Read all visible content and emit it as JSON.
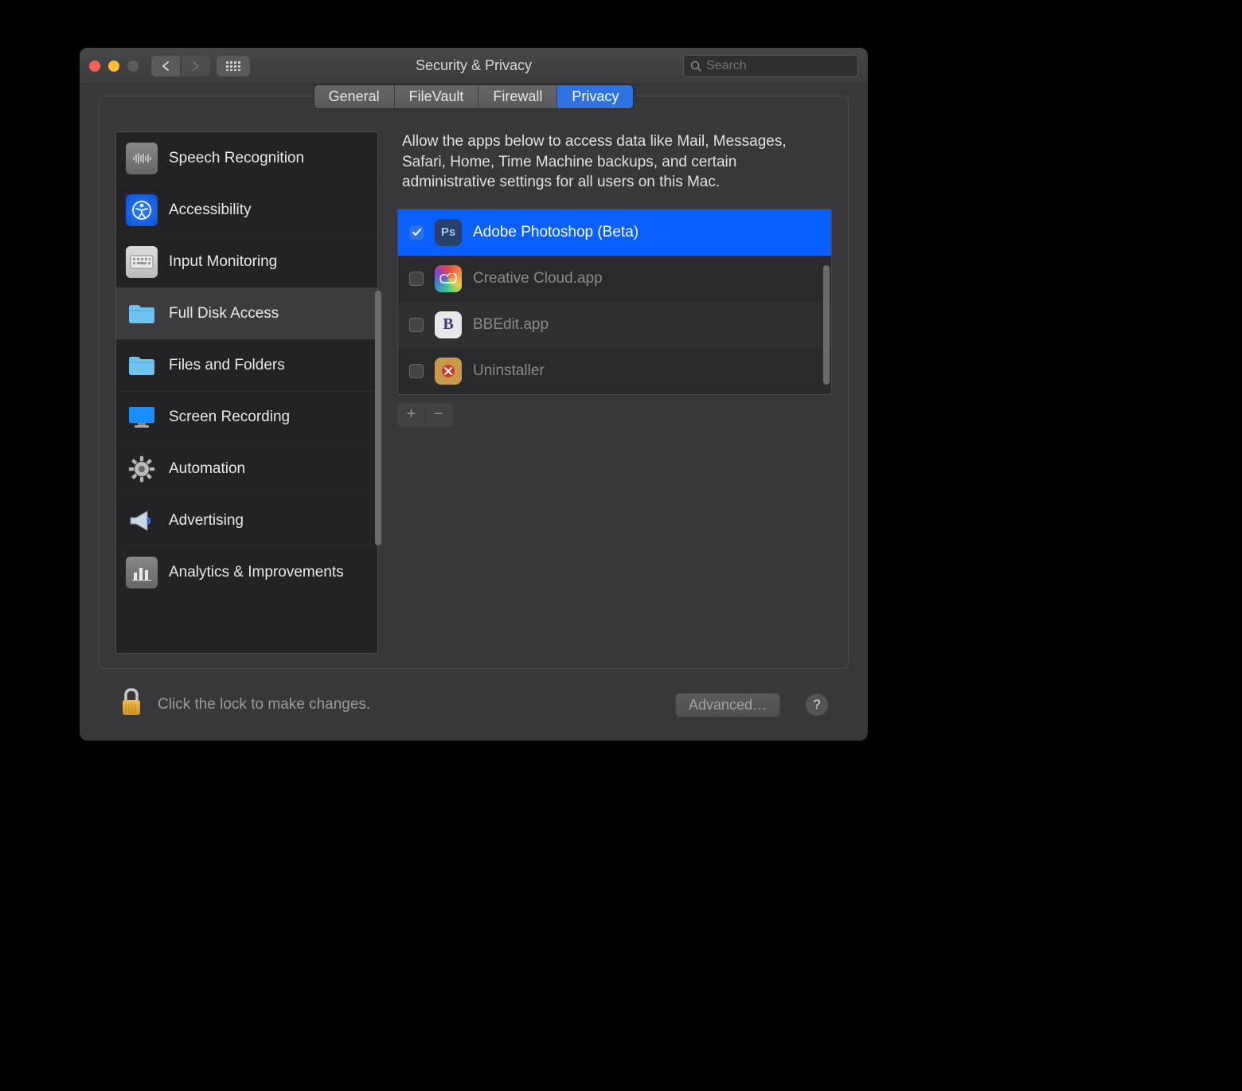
{
  "window": {
    "title": "Security & Privacy"
  },
  "search": {
    "placeholder": "Search"
  },
  "tabs": [
    {
      "label": "General",
      "active": false
    },
    {
      "label": "FileVault",
      "active": false
    },
    {
      "label": "Firewall",
      "active": false
    },
    {
      "label": "Privacy",
      "active": true
    }
  ],
  "sidebar": {
    "items": [
      {
        "label": "Speech Recognition"
      },
      {
        "label": "Accessibility"
      },
      {
        "label": "Input Monitoring"
      },
      {
        "label": "Full Disk Access"
      },
      {
        "label": "Files and Folders"
      },
      {
        "label": "Screen Recording"
      },
      {
        "label": "Automation"
      },
      {
        "label": "Advertising"
      },
      {
        "label": "Analytics & Improvements"
      }
    ],
    "selected_index": 3
  },
  "detail": {
    "description": "Allow the apps below to access data like Mail, Messages, Safari, Home, Time Machine backups, and certain administrative settings for all users on this Mac.",
    "apps": [
      {
        "name": "Adobe Photoshop (Beta)",
        "checked": true,
        "selected": true
      },
      {
        "name": "Creative Cloud.app",
        "checked": false,
        "selected": false
      },
      {
        "name": "BBEdit.app",
        "checked": false,
        "selected": false
      },
      {
        "name": "Uninstaller",
        "checked": false,
        "selected": false
      }
    ]
  },
  "footer": {
    "lock_text": "Click the lock to make changes.",
    "advanced_label": "Advanced…",
    "help_label": "?"
  }
}
